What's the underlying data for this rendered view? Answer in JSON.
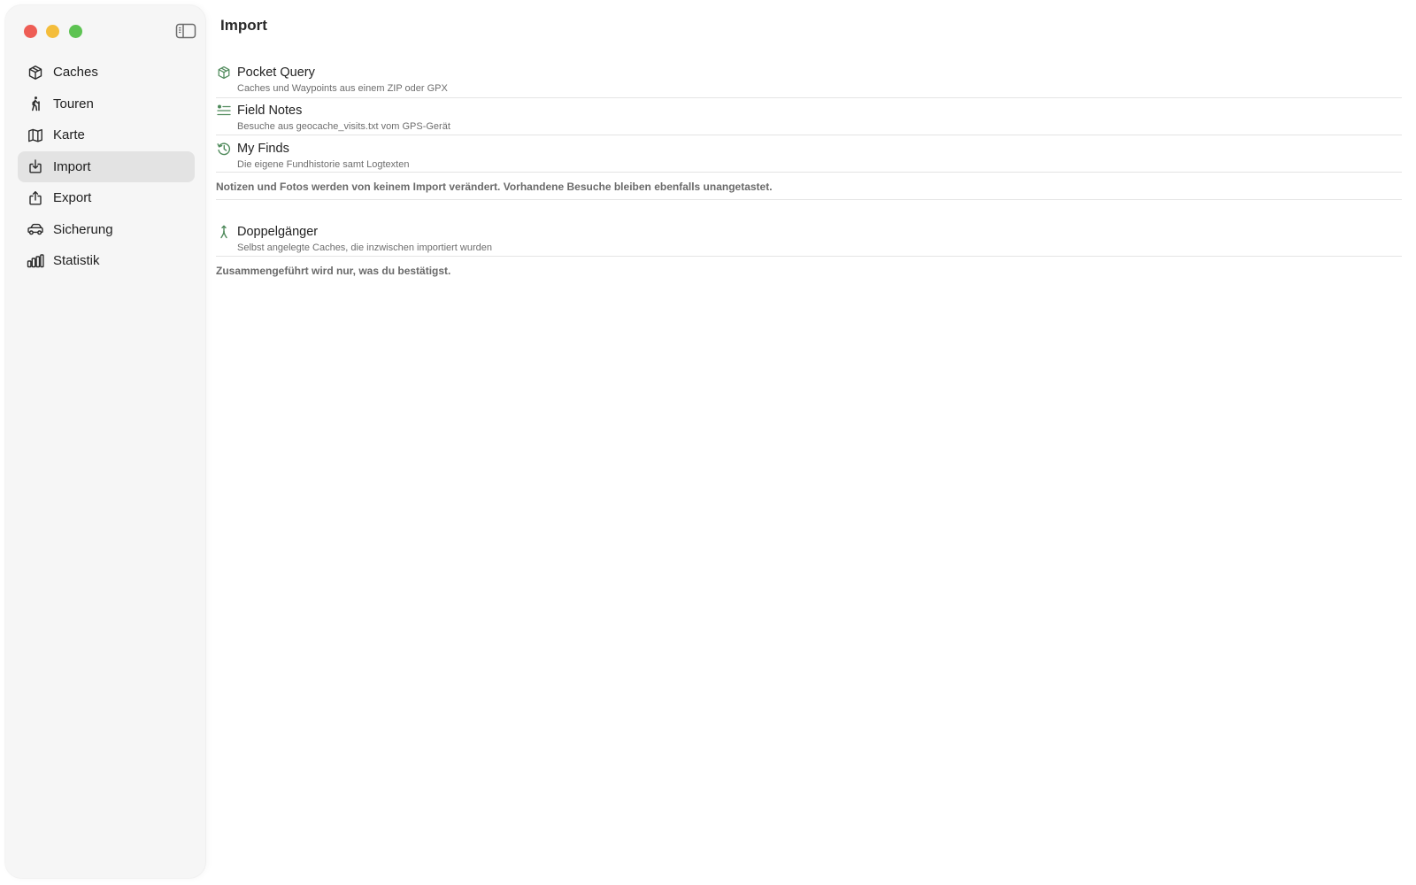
{
  "window": {
    "controls": {
      "close": "close",
      "minimize": "minimize",
      "maximize": "maximize"
    },
    "colors": {
      "close": "#ee5d55",
      "minimize": "#f4bd3b",
      "maximize": "#5dc352",
      "accent_green": "#4f8a5b"
    }
  },
  "sidebar": {
    "toggle_icon": "sidebar-left-icon",
    "items": [
      {
        "label": "Caches",
        "icon": "cube-icon",
        "active": false
      },
      {
        "label": "Touren",
        "icon": "hiker-icon",
        "active": false
      },
      {
        "label": "Karte",
        "icon": "map-icon",
        "active": false
      },
      {
        "label": "Import",
        "icon": "tray-arrow-down-icon",
        "active": true
      },
      {
        "label": "Export",
        "icon": "share-icon",
        "active": false
      },
      {
        "label": "Sicherung",
        "icon": "car-icon",
        "active": false
      },
      {
        "label": "Statistik",
        "icon": "bar-chart-icon",
        "active": false
      }
    ]
  },
  "main": {
    "title": "Import",
    "import_rows": [
      {
        "title": "Pocket Query",
        "subtitle": "Caches und Waypoints aus einem ZIP oder GPX",
        "icon": "cube-icon"
      },
      {
        "title": "Field Notes",
        "subtitle": "Besuche aus geocache_visits.txt vom GPS-Gerät",
        "icon": "checklist-icon"
      },
      {
        "title": "My Finds",
        "subtitle": "Die eigene Fundhistorie samt Logtexten",
        "icon": "history-icon"
      }
    ],
    "import_note": "Notizen und Fotos werden von keinem Import verändert. Vorhandene Besuche bleiben ebenfalls unangetastet.",
    "merge_rows": [
      {
        "title": "Doppelgänger",
        "subtitle": "Selbst angelegte Caches, die inzwischen importiert wurden",
        "icon": "merge-icon"
      }
    ],
    "merge_note": "Zusammengeführt wird nur, was du bestätigst."
  }
}
